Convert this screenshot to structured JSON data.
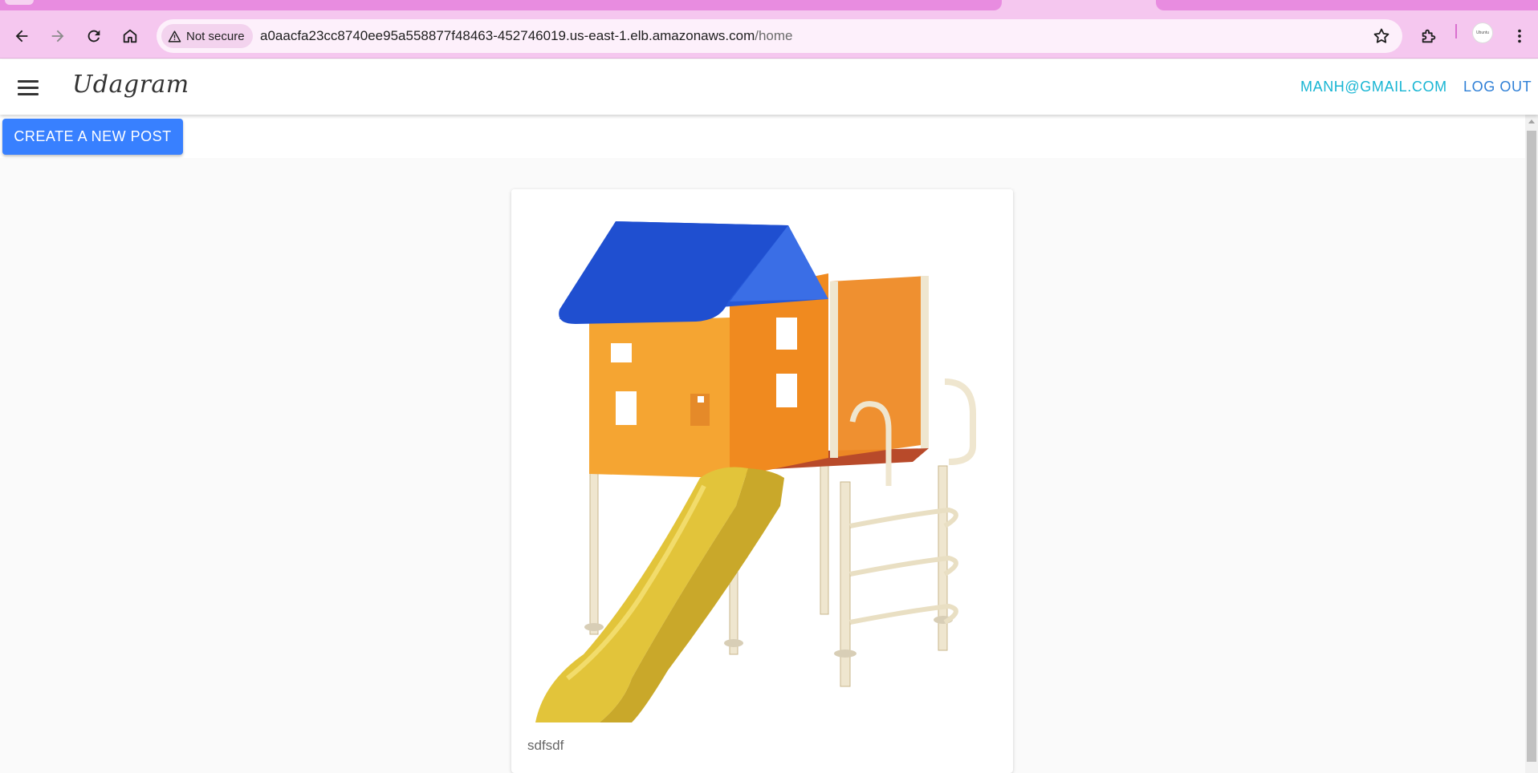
{
  "browser": {
    "security_label": "Not secure",
    "url_host": "a0aacfa23cc8740ee95a558877f48463-452746019.us-east-1.elb.amazonaws.com",
    "url_path": "/home",
    "avatar_text": "Ubuntu",
    "icons": [
      "back-arrow-icon",
      "forward-arrow-icon",
      "reload-icon",
      "home-icon",
      "warning-icon",
      "star-icon",
      "extensions-icon",
      "kebab-menu-icon"
    ],
    "theme_color": "#f5c7ef"
  },
  "header": {
    "brand": "Udagram",
    "user_email": "MANH@GMAIL.COM",
    "logout_label": "LOG OUT"
  },
  "actions": {
    "create_post_label": "CREATE A NEW POST",
    "primary_color": "#3880ff"
  },
  "posts": [
    {
      "caption": "sdfsdf",
      "image_alt": "playground playhouse with blue roof, orange walls and yellow slide"
    }
  ]
}
